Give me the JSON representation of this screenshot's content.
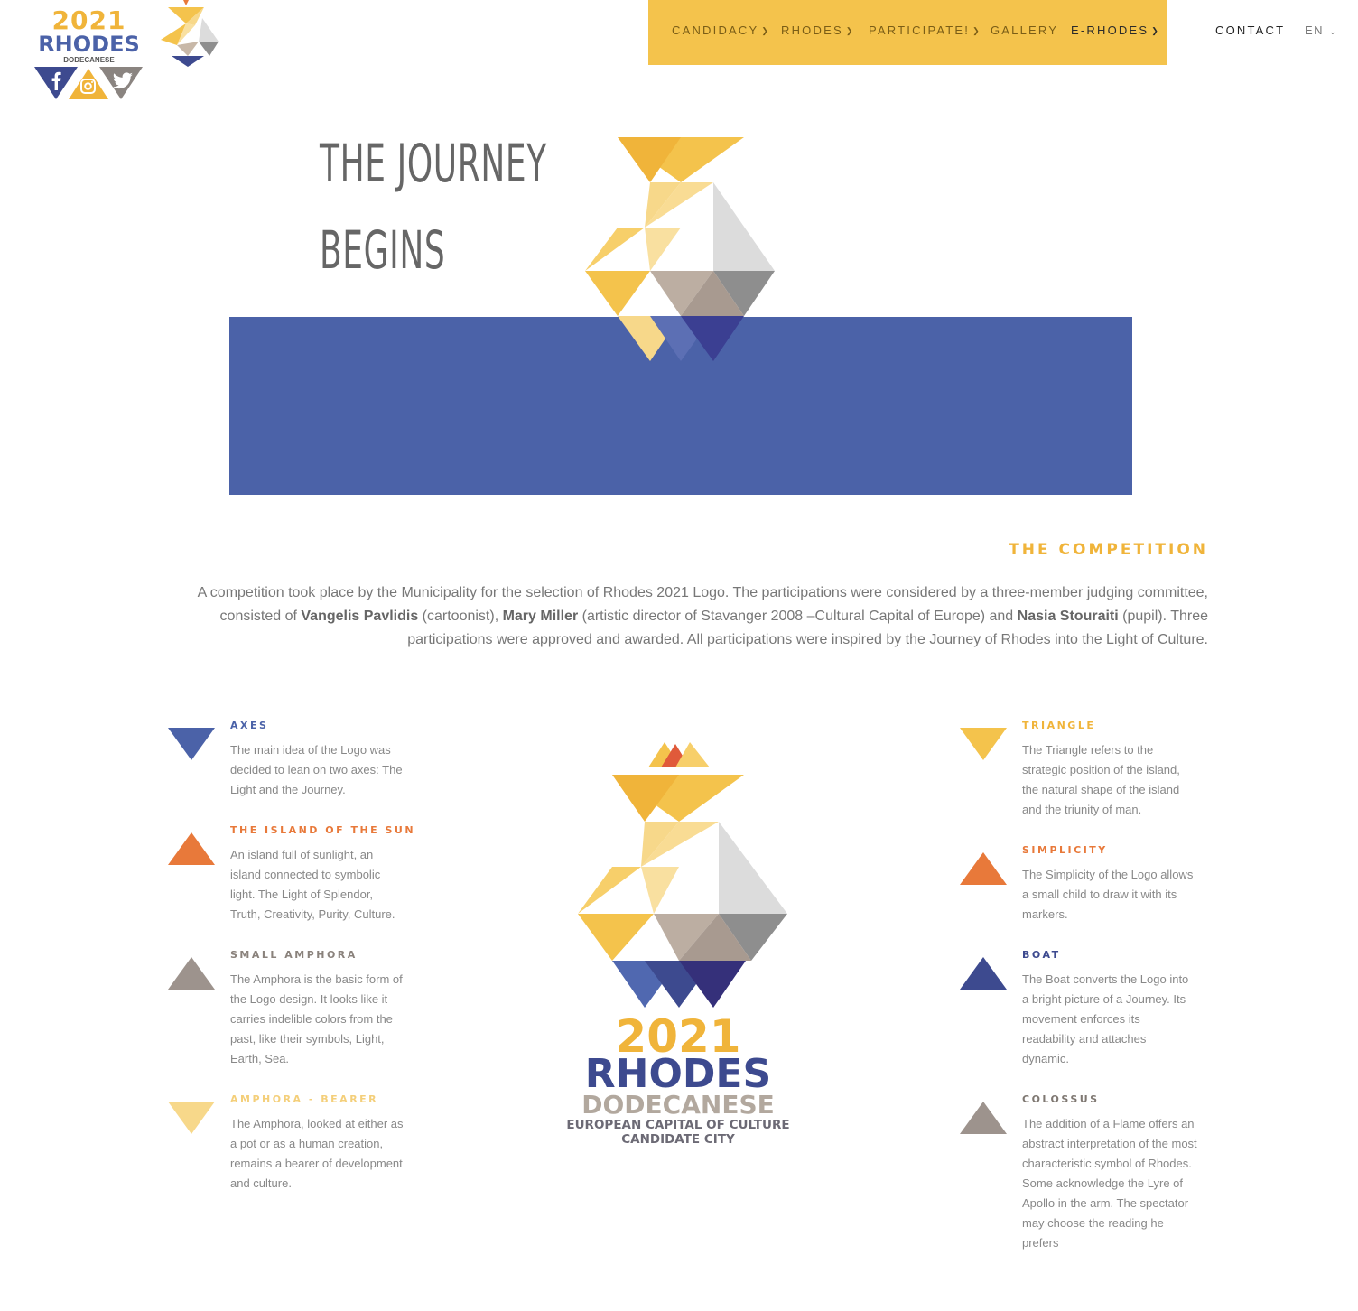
{
  "header": {
    "logo": {
      "year": "2021",
      "name": "RHODES",
      "subtitle": "DODECANESE"
    },
    "social": [
      "facebook-icon",
      "instagram-icon",
      "twitter-icon"
    ],
    "nav": [
      {
        "label": "CANDIDACY",
        "dropdown": true
      },
      {
        "label": "RHODES",
        "dropdown": true
      },
      {
        "label": "PARTICIPATE!",
        "dropdown": true
      },
      {
        "label": "GALLERY",
        "dropdown": false
      },
      {
        "label": "E-RHODES",
        "dropdown": true
      }
    ],
    "contact": "CONTACT",
    "language": "EN"
  },
  "hero": {
    "line1": "THE JOURNEY",
    "line2": "BEGINS"
  },
  "competition": {
    "heading": "THE COMPETITION",
    "text_1": "A competition took place by the Municipality for the selection of Rhodes 2021 Logo. The participations were considered by a three-member judging committee, consisted of ",
    "judge_1": "Vangelis Pavlidis",
    "text_2": " (cartoonist), ",
    "judge_2": "Mary Miller",
    "text_3": " (artistic director of Stavanger 2008 –Cultural Capital of Europe) and ",
    "judge_3": "Nasia Stouraiti",
    "text_4": " (pupil). Three participations were approved and awarded. All participations were inspired by the Journey of Rhodes into the Light of Culture."
  },
  "features_left": [
    {
      "title": "AXES",
      "color": "#4b62a8",
      "desc": "The main idea of the Logo was decided to lean on two axes: The Light and the Journey."
    },
    {
      "title": "THE ISLAND OF THE SUN",
      "color": "#e8793a",
      "desc": "An island full of sunlight, an island connected to symbolic light. The Light of Splendor, Truth, Creativity, Purity, Culture."
    },
    {
      "title": "SMALL AMPHORA",
      "color": "#9d938d",
      "desc": "The Amphora is the basic form of the Logo design. It looks like it carries indelible colors from the past, like their symbols, Light, Earth, Sea."
    },
    {
      "title": "AMPHORA - BEARER",
      "color": "#f7d88a",
      "desc": "The Amphora, looked at either as a pot or as a human creation, remains a bearer of development and culture."
    }
  ],
  "features_right": [
    {
      "title": "TRIANGLE",
      "color": "#f0b43a",
      "desc": "The Triangle refers to the strategic position of the island, the natural shape of the island and the triunity of man."
    },
    {
      "title": "SIMPLICITY",
      "color": "#e8793a",
      "desc": "The Simplicity of the Logo allows a small child to draw it with its markers."
    },
    {
      "title": "BOAT",
      "color": "#3d4a8f",
      "desc": "The Boat converts the Logo into a bright picture of a Journey. Its movement enforces its readability and attaches dynamic."
    },
    {
      "title": "COLOSSUS",
      "color": "#9d938d",
      "desc": "The addition of a Flame offers an abstract interpretation of the most characteristic symbol of Rhodes. Some acknowledge the Lyre of Apollo in the arm. The spectator may choose the reading he prefers"
    }
  ],
  "main_logo": {
    "year": "2021",
    "name": "RHODES",
    "region": "DODECANESE",
    "tagline_1": "EUROPEAN CAPITAL OF CULTURE",
    "tagline_2": "CANDIDATE CITY"
  },
  "colors": {
    "yellow": "#f4c34c",
    "blue": "#4b62a8",
    "orange": "#e8793a",
    "grey": "#9d938d"
  }
}
